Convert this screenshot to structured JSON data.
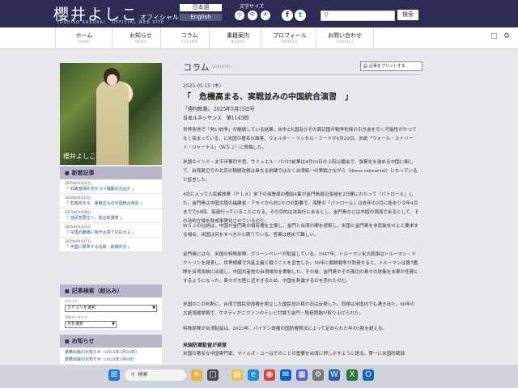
{
  "header": {
    "logo": "櫻井よしこ",
    "logo_suffix": "オフィシャルサイト",
    "logo_sub": "YOSHIKO SAKURAI - OFFICIAL WEB SITE",
    "lang_ja": "日本語",
    "lang_en": "English",
    "font_size_label": "文字サイズ",
    "font_sizes": [
      "小",
      "中",
      "大"
    ],
    "social": [
      {
        "icon": "facebook-icon",
        "glyph": "f"
      },
      {
        "icon": "twitter-icon",
        "glyph": "t"
      }
    ],
    "search_button": "検索",
    "brand_color": "#2e2b55"
  },
  "nav": [
    {
      "jp": "ホーム",
      "en": "HOME"
    },
    {
      "jp": "お知らせ",
      "en": "NEWS"
    },
    {
      "jp": "コラム",
      "en": "COLUMN"
    },
    {
      "jp": "書籍案内",
      "en": "BOOKS"
    },
    {
      "jp": "プロフィール",
      "en": "PROFILE"
    },
    {
      "jp": "お問い合わせ",
      "en": "CONTACT"
    }
  ],
  "sidebar": {
    "photo_signature": "櫻井よしこ",
    "new_articles_title": "新着記事",
    "new_articles": [
      {
        "date": "2025年05月22日",
        "title": "「 石破首相外交がコメ騒動の元凶か 」"
      },
      {
        "date": "2025年05月15日",
        "title": "「 危機高まる、実戦並みの中国統合演習 」"
      },
      {
        "date": "2025年05月08日",
        "title": "「 自民党再生へ、助言総選挙 」"
      },
      {
        "date": "2025年04月24日",
        "title": "「 中国の覇権に徳き合意で対応せよ 」"
      },
      {
        "date": "2025年04月17日",
        "title": "「 中国に照準する石破・総接外交 」"
      }
    ],
    "search_title": "記事検索（絞込み）",
    "category_label": "カテゴリ",
    "category_value": "カテゴリを選択",
    "archive_label": "月別アーカイブ",
    "archive_value": "月を選択",
    "notice_title": "お知らせ",
    "notices": [
      "書籍出版のお知らせ（2025年1月26日）",
      "書籍出版のお知らせ（2025年1月8日）"
    ]
  },
  "main": {
    "title": "コラム",
    "title_en": "Column",
    "print_button": "記事をプリントする",
    "date": "2025.05.15 (木)",
    "article_title": "「　危機高まる、実戦並みの中国統合演習　」",
    "meta_lines": [
      "『週刊新潮』 2025年5月15日号",
      "日本ルネッサンス　第1145回"
    ],
    "paragraphs": [
      "世界各地で「熱い紛争」が継続している結果、米中2大国及びその周辺国が戦争勃発の引き金を引く可能性がかつてなく高まっている、と米国の著名な論客、ウォルター・ラッセル・ミードが4月29日、米紙「ウォール・ストリート・ジャーナル」（ＷＳＪ）に寄稿した。",
      "米国のインド・太平洋軍司令官、サミュエル・パパロ前軍は4月10日の上院公聴会で、強軍化を進める中国に関して、台湾周辺での北京の積極攻勢は単なる訓練ではなく台湾統一の実戦さながら（dress rehearsal）になっていると証言した。",
      "4月に入って人民解放軍（ＰＬＡ）傘下の海警局の艦船4隻が金門島周辺海域を2日間にわたって「パトロール」した。金門島は中国大陸の福建省・アモイから約2キロの距離で、海警の「パトロール」は去年の2月に始まり今年4月までで68回、毎週行っていることになる。その目的は法執行にあるとし、金門島などは中国の領海であるとして、その法的立場を既成事実化させているのだ。",
      "ＷＳＪの社説は、中国が金門島の領有権を主張し、金門と台湾の間を遮断し、米国と金門島を非武装化せよと要求する場合、米国は何をすべきかと問うている。答案は極めて難しい。",
      "金門島には今、米国の特殊部隊、グリーンベレーが駐留している。1947年、トルーマン米大統領はトルーマン・ドクトリンを発表し、世界規模で共産主義と戦うことを宣言した。50年に朝鮮戦争が勃発すると、トルーマンは第7艦隊を台湾海峡に派遣し、中国共産党の台湾侵攻を牽制した。その後、金門島やその周辺の島々の防衛を米軍が任務とするようになった。島々が大陸に近すぎるため、中国を刺激するのを恐れたのだ。",
      "米国のこの判断に、台湾で国民党政権を樹立した国民党の蒋介石は反発した。同様は米国内でも湧き出た。60年の大統領選挙戦で、ケネディがニクソンのテレビ討論で金門・馬祖問題が取り上げられた。",
      "特殊部隊が台湾駐留は、2023年、バイデン政権の国防権限法によって定められた年の5割を超える。"
    ],
    "subhead": "米国防軍駐留が発覚",
    "last_para": "米国の著名な中国専門家、マイルズ・ユーはそのことの重要を台湾に押し示すように語る。第一に米国防戦部"
  },
  "taskbar": {
    "search_label": "検索",
    "icons": [
      "windows-icon",
      "file-explorer-icon",
      "edge-icon",
      "chrome-icon",
      "mail-icon",
      "store-icon",
      "settings-icon"
    ]
  }
}
